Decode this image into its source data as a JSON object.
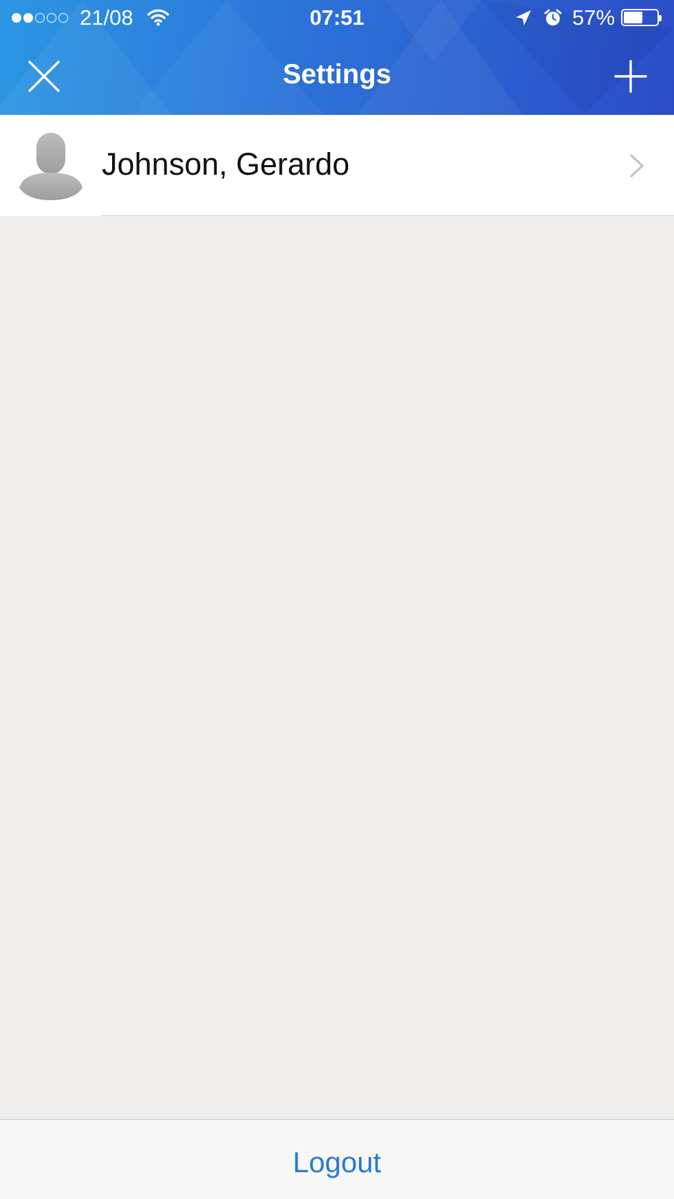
{
  "status_bar": {
    "date": "21/08",
    "time": "07:51",
    "battery_percent_label": "57%",
    "battery_level": 0.57,
    "signal_bars_filled": 2,
    "signal_bars_total": 5
  },
  "header": {
    "title": "Settings",
    "close_icon": "close-icon",
    "add_icon": "plus-icon"
  },
  "account": {
    "name": "Johnson, Gerardo",
    "avatar_icon": "person-placeholder-icon",
    "chevron_icon": "chevron-right-icon"
  },
  "footer": {
    "logout_label": "Logout"
  },
  "colors": {
    "header_start": "#2b97e4",
    "header_end": "#2b4cc6",
    "background": "#efeeec",
    "link": "#2a7ad4"
  }
}
